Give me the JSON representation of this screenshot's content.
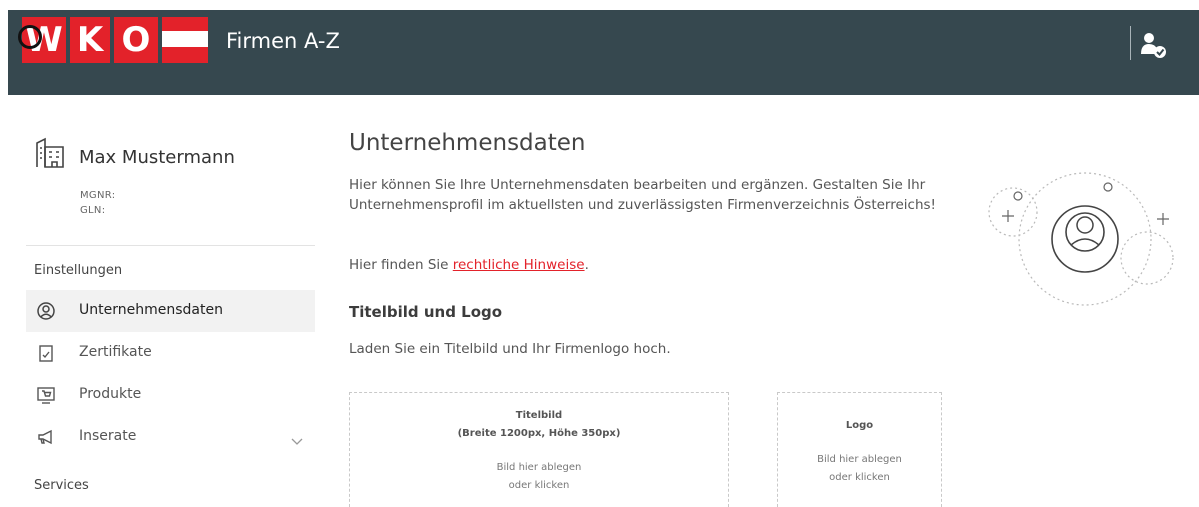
{
  "header": {
    "logo_letters": [
      "W",
      "K",
      "O"
    ],
    "app_title": "Firmen A-Z",
    "brand_color": "#e3222a",
    "header_bg": "#36484f",
    "user_menu_icon": "user-check-icon"
  },
  "sidebar": {
    "company_icon": "building-icon",
    "user_name": "Max Mustermann",
    "mgnr_label": "MGNR:",
    "gln_label": "GLN:",
    "settings_label": "Einstellungen",
    "items": [
      {
        "label": "Unternehmensdaten",
        "icon": "profile-icon",
        "active": true
      },
      {
        "label": "Zertifikate",
        "icon": "certificate-icon",
        "active": false
      },
      {
        "label": "Produkte",
        "icon": "product-icon",
        "active": false
      },
      {
        "label": "Inserate",
        "icon": "megaphone-icon",
        "active": false,
        "expandable": true
      }
    ],
    "services_label": "Services"
  },
  "main": {
    "title": "Unternehmensdaten",
    "intro": "Hier können Sie Ihre Unternehmensdaten bearbeiten und ergänzen. Gestalten Sie Ihr Unternehmensprofil im aktuellsten und zuverlässigsten Firmenverzeichnis Österreichs!",
    "hint_prefix": "Hier finden Sie ",
    "hint_link": "rechtliche Hinweise",
    "hint_suffix": ".",
    "upload_title": "Titelbild und Logo",
    "upload_text": "Laden Sie ein Titelbild und Ihr Firmenlogo hoch.",
    "cover": {
      "title": "Titelbild",
      "size_hint": "(Breite 1200px, Höhe 350px)",
      "drop_line1": "Bild hier ablegen",
      "drop_line2": "oder klicken"
    },
    "logo": {
      "title": "Logo",
      "drop_line1": "Bild hier ablegen",
      "drop_line2": "oder klicken"
    }
  }
}
